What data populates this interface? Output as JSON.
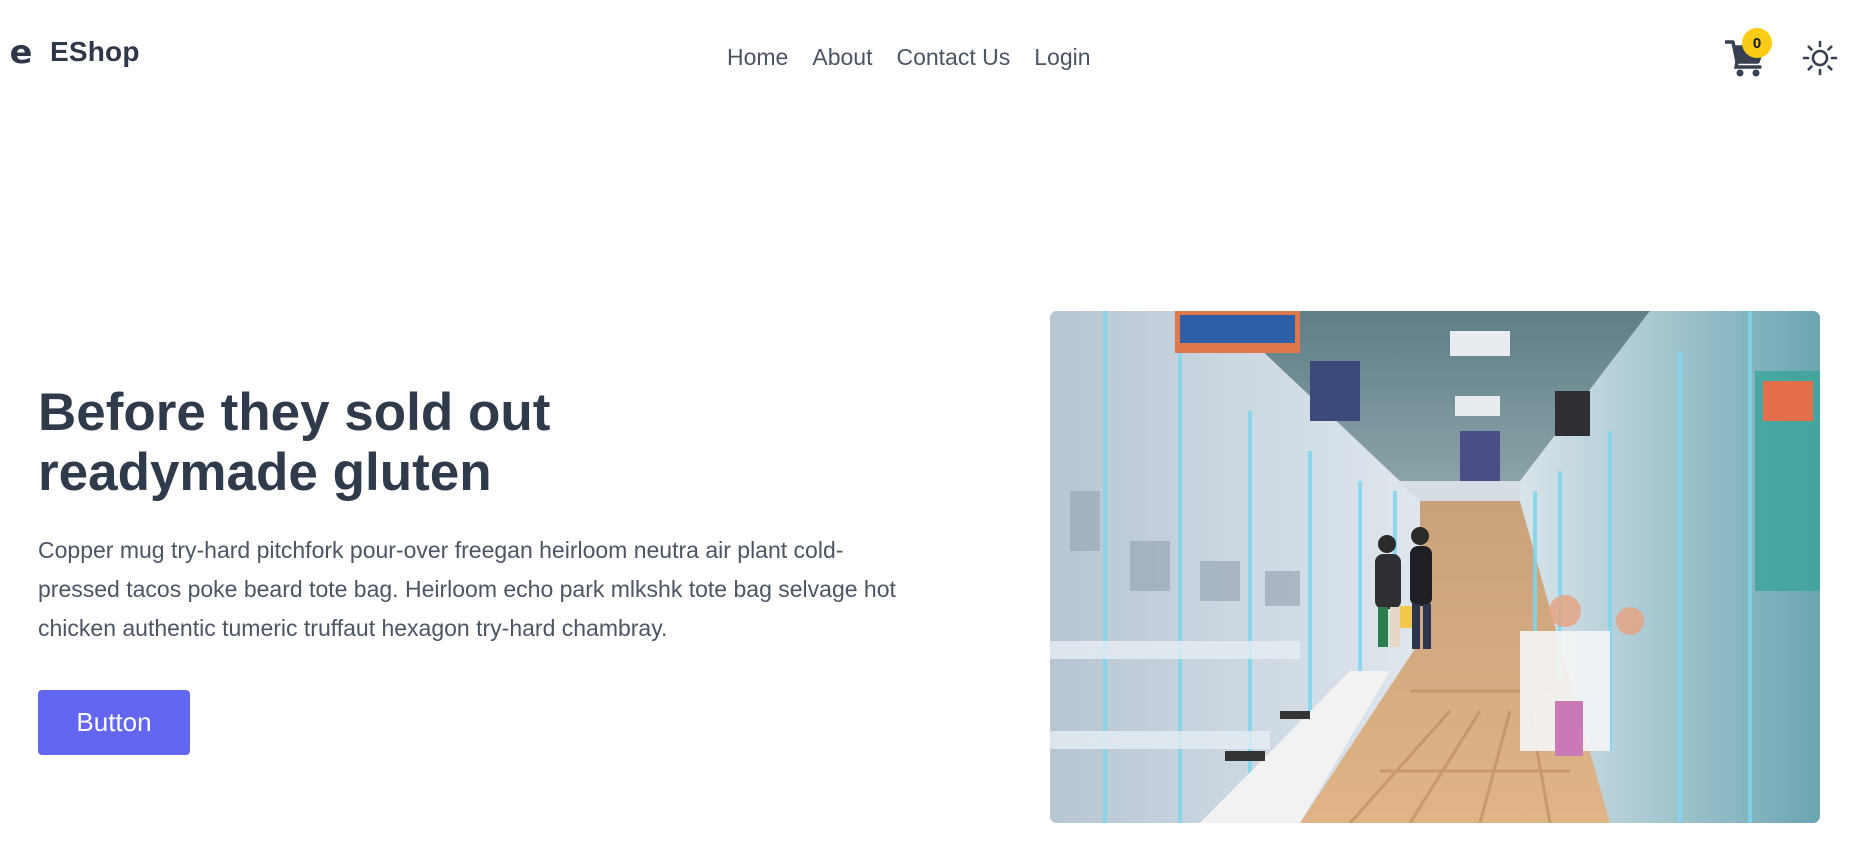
{
  "brand": {
    "name": "EShop",
    "logo_icon": "e-logo-icon"
  },
  "nav": {
    "links": [
      "Home",
      "About",
      "Contact Us",
      "Login"
    ]
  },
  "cart": {
    "icon": "shopping-cart-icon",
    "count": "0",
    "badge_color": "#facc15"
  },
  "theme_toggle": {
    "icon": "sun-icon"
  },
  "hero": {
    "title": "Before they sold out readymade gluten",
    "body": "Copper mug try-hard pitchfork pour-over freegan heirloom neutra air plant cold-pressed tacos poke beard tote bag. Heirloom echo park mlkshk tote bag selvage hot chicken authentic tumeric truffaut hexagon try-hard chambray.",
    "button_label": "Button",
    "button_color": "#6366f1",
    "image_alt": "hero-photo-arcade-store"
  },
  "colors": {
    "text_dark": "#2f3a4b",
    "text_body": "#4b5563"
  }
}
